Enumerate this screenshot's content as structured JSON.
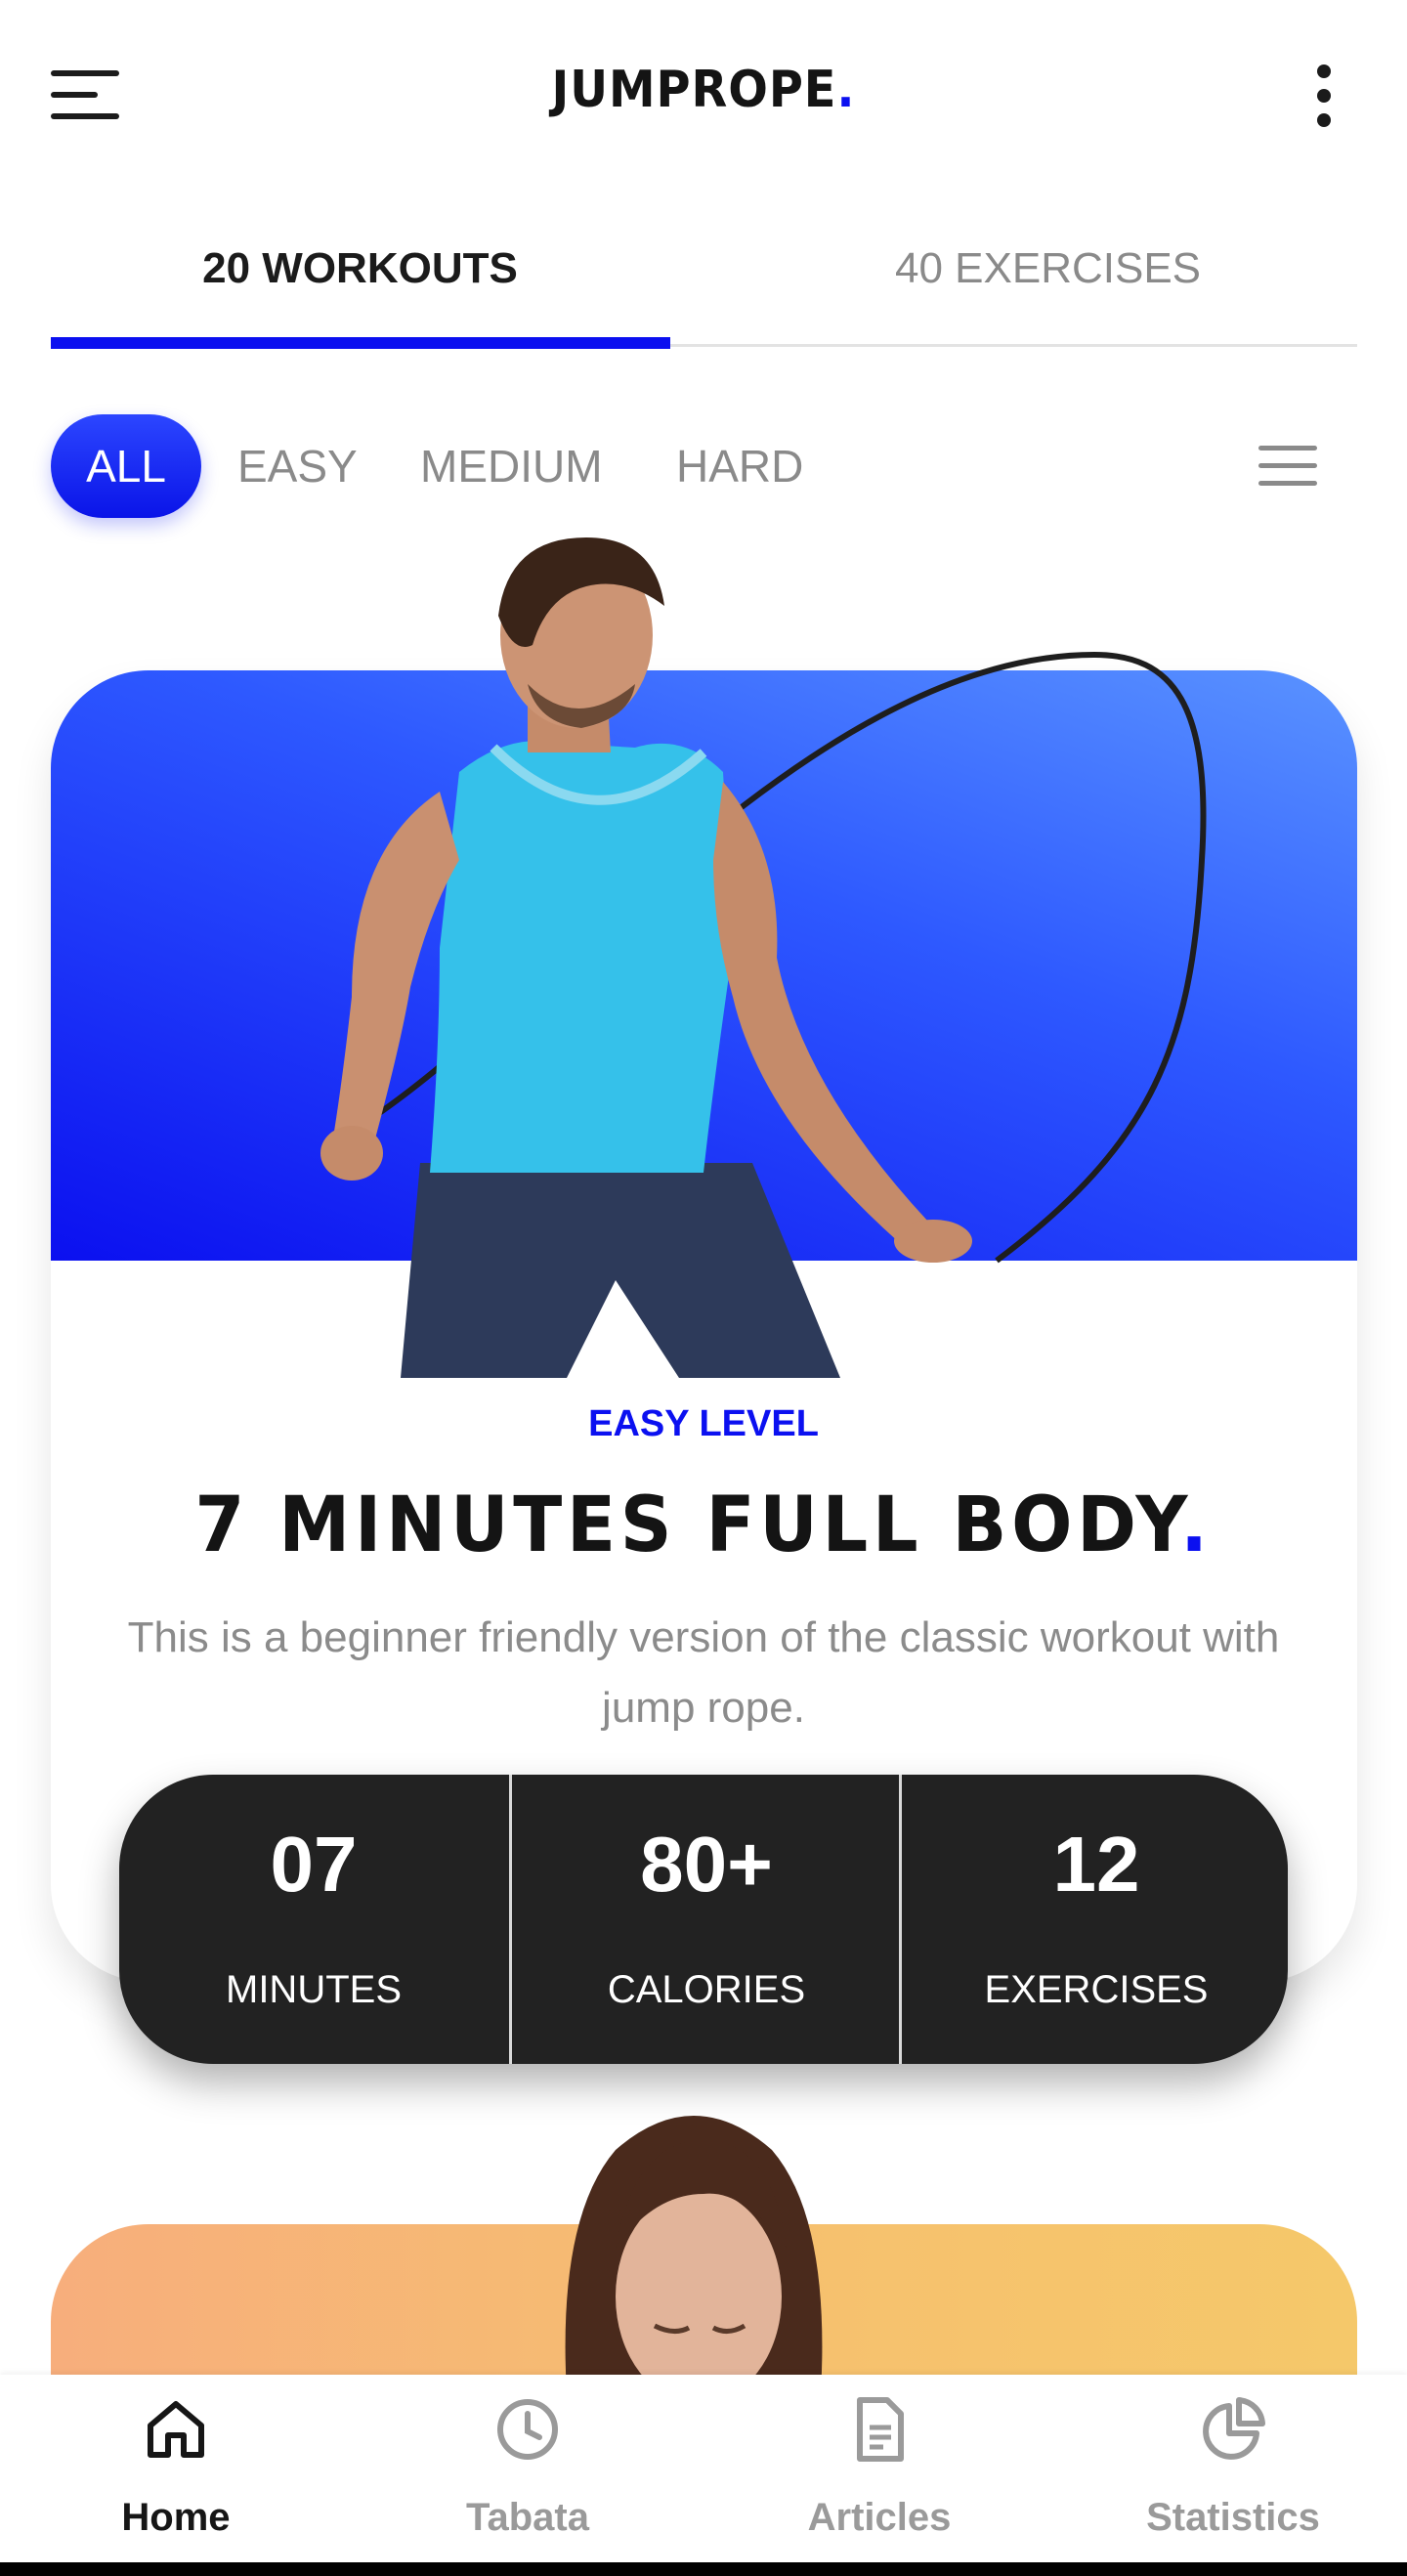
{
  "app": {
    "brand": "JUMPROPE",
    "brand_dot": "."
  },
  "tabs": [
    {
      "label": "20 WORKOUTS",
      "active": true
    },
    {
      "label": "40 EXERCISES",
      "active": false
    }
  ],
  "filters": {
    "chips": [
      {
        "label": "ALL",
        "active": true
      },
      {
        "label": "EASY",
        "active": false
      },
      {
        "label": "MEDIUM",
        "active": false
      },
      {
        "label": "HARD",
        "active": false
      }
    ]
  },
  "workouts": [
    {
      "level": "EASY LEVEL",
      "title": "7 MINUTES FULL BODY",
      "title_dot": ".",
      "description": "This is a beginner friendly version of the classic workout with jump rope.",
      "stats": [
        {
          "value": "07",
          "label": "MINUTES"
        },
        {
          "value": "80+",
          "label": "CALORIES"
        },
        {
          "value": "12",
          "label": "EXERCISES"
        }
      ]
    }
  ],
  "bottom_nav": [
    {
      "label": "Home",
      "icon": "home-icon",
      "active": true
    },
    {
      "label": "Tabata",
      "icon": "clock-icon",
      "active": false
    },
    {
      "label": "Articles",
      "icon": "document-icon",
      "active": false
    },
    {
      "label": "Statistics",
      "icon": "pie-chart-icon",
      "active": false
    }
  ],
  "colors": {
    "accent": "#0b10f0",
    "dark": "#222222",
    "muted": "#8a8a8a",
    "card2_gradient_start": "#f7ae7c",
    "card2_gradient_end": "#f5c86a"
  }
}
